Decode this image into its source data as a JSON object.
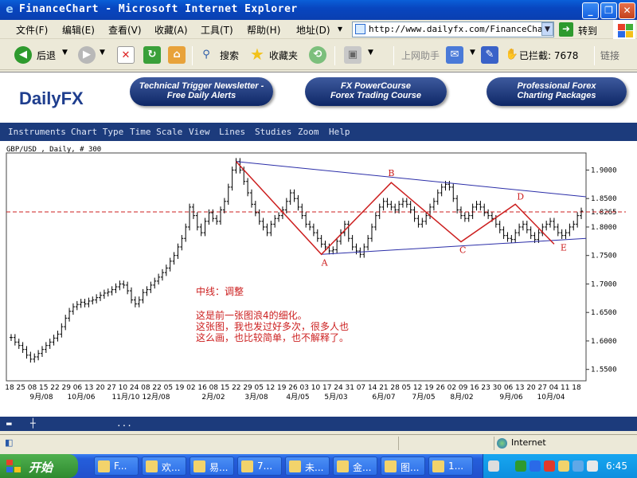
{
  "window": {
    "title": "FinanceChart - Microsoft Internet Explorer",
    "ie_icon_glyph": "e"
  },
  "menu": {
    "items": [
      "文件(F)",
      "编辑(E)",
      "查看(V)",
      "收藏(A)",
      "工具(T)",
      "帮助(H)"
    ],
    "address_label": "地址(D)",
    "address_value": "http://www.dailyfx.com/FinanceChart.",
    "go_label": "转到"
  },
  "toolbar": {
    "back": "后退",
    "search": "搜索",
    "favorites": "收藏夹",
    "online_helper": "上网助手",
    "blocked": "已拦截: 7678",
    "links": "链接"
  },
  "site": {
    "logo_main": "Daily",
    "logo_fx": "FX",
    "promo1_line1": "Technical Trigger Newsletter -",
    "promo1_line2": "Free Daily Alerts",
    "promo2_line1": "FX PowerCourse",
    "promo2_line2": "Forex Trading Course",
    "promo3_line1": "Professional Forex",
    "promo3_line2": "Charting Packages",
    "nav": [
      "Instruments",
      "Chart Type",
      "Time Scale",
      "View",
      "Lines",
      "Studies",
      "Zoom",
      "Help"
    ]
  },
  "chart_data": {
    "type": "candlestick",
    "caption": "GBP/USD , Daily, # 300",
    "y_axis_ticks": [
      "1.9000",
      "1.8500",
      "1.8265",
      "1.8000",
      "1.7500",
      "1.7000",
      "1.6500",
      "1.6000",
      "1.5500"
    ],
    "ylim": [
      1.53,
      1.93
    ],
    "reference_level": 1.8265,
    "x_tick_labels": [
      "18",
      "25",
      "08",
      "15",
      "22",
      "29",
      "06",
      "13",
      "20",
      "27",
      "10",
      "24",
      "08",
      "22",
      "05",
      "19",
      "02",
      "16",
      "08",
      "15",
      "22",
      "29",
      "05",
      "12",
      "19",
      "26",
      "03",
      "10",
      "17",
      "24",
      "31",
      "07",
      "14",
      "21",
      "28",
      "05",
      "12",
      "19",
      "26",
      "02",
      "09",
      "16",
      "23",
      "30",
      "06",
      "13",
      "20",
      "27",
      "04",
      "11",
      "18"
    ],
    "x_month_labels": [
      "9月/08",
      "10月/06",
      "11月/10",
      "12月/08",
      "2月/02",
      "3月/08",
      "4月/05",
      "5月/03",
      "6月/07",
      "7月/05",
      "8月/02",
      "9月/06",
      "10月/04"
    ],
    "closes": [
      1.606,
      1.598,
      1.592,
      1.585,
      1.575,
      1.568,
      1.572,
      1.578,
      1.585,
      1.592,
      1.598,
      1.605,
      1.612,
      1.625,
      1.64,
      1.652,
      1.66,
      1.664,
      1.668,
      1.665,
      1.67,
      1.672,
      1.676,
      1.68,
      1.684,
      1.686,
      1.69,
      1.695,
      1.7,
      1.698,
      1.688,
      1.672,
      1.665,
      1.672,
      1.685,
      1.69,
      1.698,
      1.705,
      1.712,
      1.72,
      1.728,
      1.74,
      1.75,
      1.765,
      1.78,
      1.8,
      1.835,
      1.82,
      1.8,
      1.79,
      1.81,
      1.825,
      1.815,
      1.81,
      1.83,
      1.845,
      1.87,
      1.9,
      1.915,
      1.9,
      1.88,
      1.86,
      1.84,
      1.825,
      1.81,
      1.8,
      1.79,
      1.805,
      1.815,
      1.82,
      1.83,
      1.845,
      1.86,
      1.85,
      1.835,
      1.82,
      1.805,
      1.8,
      1.79,
      1.78,
      1.77,
      1.765,
      1.758,
      1.76,
      1.775,
      1.79,
      1.805,
      1.78,
      1.765,
      1.758,
      1.752,
      1.765,
      1.78,
      1.8,
      1.82,
      1.835,
      1.845,
      1.84,
      1.835,
      1.83,
      1.84,
      1.845,
      1.84,
      1.83,
      1.815,
      1.805,
      1.81,
      1.82,
      1.835,
      1.845,
      1.86,
      1.87,
      1.875,
      1.87,
      1.85,
      1.83,
      1.82,
      1.815,
      1.82,
      1.835,
      1.84,
      1.835,
      1.825,
      1.82,
      1.815,
      1.805,
      1.795,
      1.785,
      1.78,
      1.778,
      1.79,
      1.8,
      1.805,
      1.795,
      1.785,
      1.778,
      1.79,
      1.8,
      1.805,
      1.81,
      1.8,
      1.79,
      1.785,
      1.79,
      1.8,
      1.805,
      1.82,
      1.828
    ],
    "wave_points": [
      {
        "label": "A",
        "x_index": 80,
        "y": 1.752
      },
      {
        "label": "B",
        "x_index": 98,
        "y": 1.878
      },
      {
        "label": "C",
        "x_index": 116,
        "y": 1.774
      },
      {
        "label": "D",
        "x_index": 130,
        "y": 1.84
      },
      {
        "label": "E",
        "x_index": 140,
        "y": 1.77
      }
    ],
    "peak_index": 58,
    "peak_value": 1.915,
    "annotation_title": "中线：调整",
    "annotation_lines": [
      "这是前一张图浪4的细化。",
      "这张图，我也发过好多次，很多人也",
      "这么画，也比较简单，也不解释了。"
    ],
    "colors": {
      "candles": "#000000",
      "wave": "#cc1f1f",
      "triangle": "#2b2ea8",
      "reference": "#cc1f1f",
      "text": "#cc1f1f"
    }
  },
  "status": {
    "zone": "Internet"
  },
  "taskbar": {
    "start": "开始",
    "tasks": [
      "F...",
      "欢...",
      "易...",
      "7...",
      "未...",
      "金...",
      "图...",
      "1..."
    ],
    "clock": "6:45"
  }
}
